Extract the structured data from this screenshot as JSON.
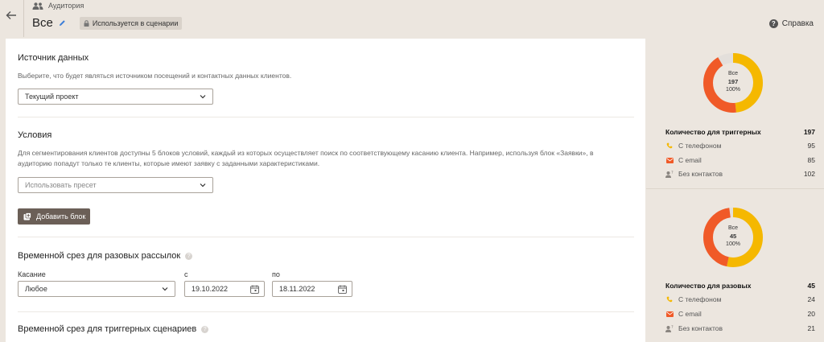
{
  "header": {
    "breadcrumb": "Аудитория",
    "title": "Все",
    "badge": "Используется в сценарии",
    "help": "Справка"
  },
  "source": {
    "title": "Источник данных",
    "description": "Выберите, что будет являться источником посещений и контактных данных клиентов.",
    "select_value": "Текущий проект"
  },
  "conditions": {
    "title": "Условия",
    "description_line1": "Для сегментирования клиентов доступны 5 блоков условий, каждый из которых осуществляет поиск по соответствующему касанию клиента. Например, используя блок «Заявки», в",
    "description_line2": "аудиторию попадут только те клиенты, которые имеют заявку с заданными характеристиками.",
    "preset_placeholder": "Использовать пресет",
    "add_block": "Добавить блок"
  },
  "one_time_slice": {
    "title": "Временной срез для разовых рассылок",
    "touch_label": "Касание",
    "touch_value": "Любое",
    "from_label": "с",
    "from_value": "19.10.2022",
    "to_label": "по",
    "to_value": "18.11.2022"
  },
  "trigger_slice": {
    "title": "Временной срез для триггерных сценариев"
  },
  "colors": {
    "phone": "#f5b800",
    "email": "#f05a28",
    "none": "#e3dfdb",
    "accent_button": "#6b5f57"
  },
  "stats_trigger": {
    "donut_label": "Все",
    "donut_total": "197",
    "donut_percent": "100%",
    "head_label": "Количество для триггерных",
    "head_value": "197",
    "rows": [
      {
        "icon": "phone-icon",
        "label": "С телефоном",
        "value": "95"
      },
      {
        "icon": "email-icon",
        "label": "С email",
        "value": "85"
      },
      {
        "icon": "no-contact-icon",
        "label": "Без контактов",
        "value": "102"
      }
    ]
  },
  "stats_one_time": {
    "donut_label": "Все",
    "donut_total": "45",
    "donut_percent": "100%",
    "head_label": "Количество для разовых",
    "head_value": "45",
    "rows": [
      {
        "icon": "phone-icon",
        "label": "С телефоном",
        "value": "24"
      },
      {
        "icon": "email-icon",
        "label": "С email",
        "value": "20"
      },
      {
        "icon": "no-contact-icon",
        "label": "Без контактов",
        "value": "21"
      }
    ]
  }
}
